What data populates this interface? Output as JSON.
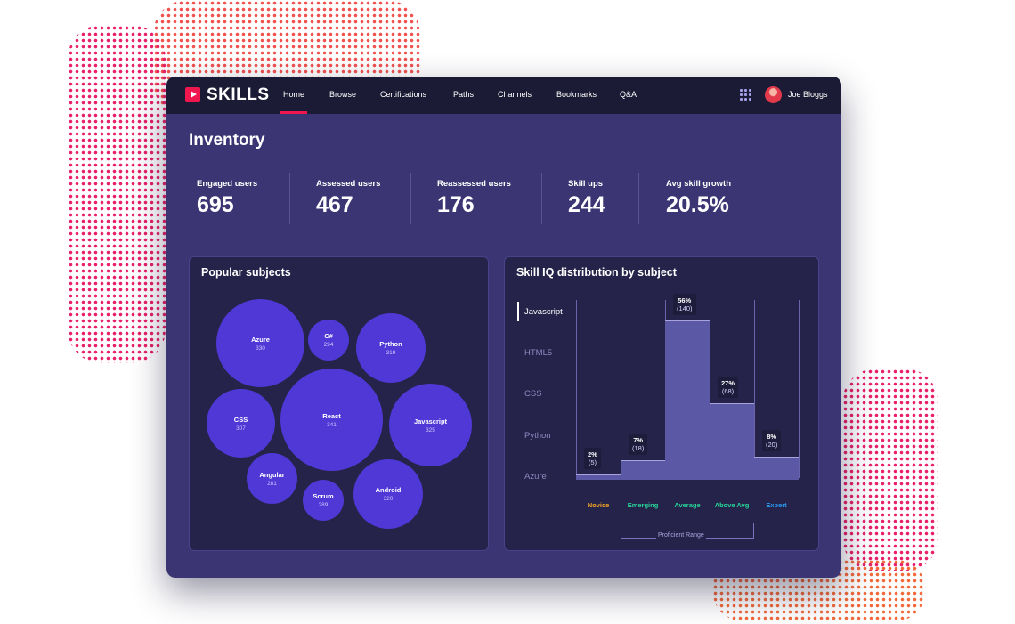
{
  "nav": {
    "brand": "SKILLS",
    "items": [
      "Home",
      "Browse",
      "Certifications",
      "Paths",
      "Channels",
      "Bookmarks",
      "Q&A"
    ],
    "active": "Home",
    "user": "Joe Bloggs"
  },
  "page": {
    "title": "Inventory"
  },
  "stats": [
    {
      "label": "Engaged users",
      "value": "695"
    },
    {
      "label": "Assessed users",
      "value": "467"
    },
    {
      "label": "Reassessed users",
      "value": "176"
    },
    {
      "label": "Skill ups",
      "value": "244"
    },
    {
      "label": "Avg skill growth",
      "value": "20.5%"
    }
  ],
  "popular": {
    "title": "Popular subjects",
    "bubbles": [
      {
        "label": "Azure",
        "value": "330"
      },
      {
        "label": "C#",
        "value": "294"
      },
      {
        "label": "Python",
        "value": "319"
      },
      {
        "label": "CSS",
        "value": "307"
      },
      {
        "label": "React",
        "value": "341"
      },
      {
        "label": "Javascript",
        "value": "325"
      },
      {
        "label": "Angular",
        "value": "281"
      },
      {
        "label": "Scrum",
        "value": "289"
      },
      {
        "label": "Android",
        "value": "320"
      }
    ]
  },
  "distribution": {
    "title": "Skill IQ distribution by subject",
    "subjects": [
      "Javascript",
      "HTML5",
      "CSS",
      "Python",
      "Azure"
    ],
    "active_subject": "Javascript",
    "range_label": "Proficient Range"
  },
  "chart_data": {
    "type": "bar",
    "title": "Skill IQ distribution by subject",
    "categories": [
      "Novice",
      "Emerging",
      "Average",
      "Above Avg",
      "Expert"
    ],
    "series": [
      {
        "name": "Javascript",
        "values": [
          2,
          7,
          56,
          27,
          8
        ],
        "counts": [
          5,
          18,
          140,
          68,
          20
        ]
      }
    ],
    "labels": [
      "2%",
      "(5)",
      "7%",
      "(18)",
      "56%",
      "(140)",
      "27%",
      "(68)",
      "8%",
      "(20)"
    ],
    "category_colors": [
      "#f5a623",
      "#26d89a",
      "#26d89a",
      "#26d89a",
      "#2a9df4"
    ],
    "ylim": [
      0,
      60
    ]
  }
}
